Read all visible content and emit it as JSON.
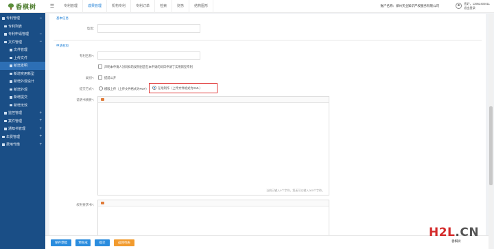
{
  "logo": {
    "text": "香棋树"
  },
  "topbar": {
    "tabs": [
      "专利管理",
      "成果管理",
      "机构专利",
      "专利订单",
      "检索",
      "财务",
      "结构图形"
    ],
    "active_tab": 1,
    "account_label": "账户名称：郑州天业知识产权服务有限公司",
    "user_line1": "您好，13952402011",
    "user_line2": "退出登录"
  },
  "sidebar": {
    "items": [
      {
        "label": "专利管理",
        "level": 1,
        "pm": "−"
      },
      {
        "label": "专利列表",
        "level": 2,
        "pm": ""
      },
      {
        "label": "专利申请管理",
        "level": 2,
        "pm": "−"
      },
      {
        "label": "文件管理",
        "level": 2,
        "pm": "−"
      },
      {
        "label": "文件管理",
        "level": 3,
        "pm": ""
      },
      {
        "label": "上传文件",
        "level": 3,
        "pm": ""
      },
      {
        "label": "新增发明",
        "level": 3,
        "pm": "",
        "active": true
      },
      {
        "label": "新增实用新型",
        "level": 3,
        "pm": ""
      },
      {
        "label": "新增外观设计",
        "level": 3,
        "pm": ""
      },
      {
        "label": "新增外观",
        "level": 3,
        "pm": ""
      },
      {
        "label": "新增提交",
        "level": 3,
        "pm": ""
      },
      {
        "label": "新增无效",
        "level": 3,
        "pm": ""
      },
      {
        "label": "监控管理",
        "level": 2,
        "pm": "+"
      },
      {
        "label": "案件管理",
        "level": 2,
        "pm": "+"
      },
      {
        "label": "通知书管理",
        "level": 2,
        "pm": "+"
      },
      {
        "label": "年费管理",
        "level": 1,
        "pm": "+"
      },
      {
        "label": "费用代缴",
        "level": 1,
        "pm": "+"
      }
    ]
  },
  "form": {
    "section1_title": "基本信息",
    "phone_label": "电话：",
    "section2_title": "申请材料",
    "name_label": "专利名称*：",
    "declaration_text": "声明本申请人对同样的发明创造在本申请的同日申请了实用新型专利",
    "disclosure_label": "类别*：",
    "early_publish_text": "提前公开",
    "method_label": "提交方式*：",
    "option1_text": "模版上传（上传文件格式为PDF）",
    "option2_text": "在线制作（上传文件格式为XML）",
    "spec_label": "说明书摘要*：",
    "counter1": "当前已输入0个字符，您还可以输入300个字符。",
    "claims_label": "权利要求书*："
  },
  "buttons": {
    "save_draft": "保存草稿",
    "preview": "预生成",
    "submit": "提交",
    "later": "返回列表"
  },
  "watermark": {
    "red": "H2L",
    "grey": ".CN",
    "sub": "香棋树"
  },
  "colors": {
    "sidebar": "#1a4e86",
    "accent": "#1e7fd6",
    "highlight": "#e03b3b",
    "orange": "#f29b2e"
  }
}
